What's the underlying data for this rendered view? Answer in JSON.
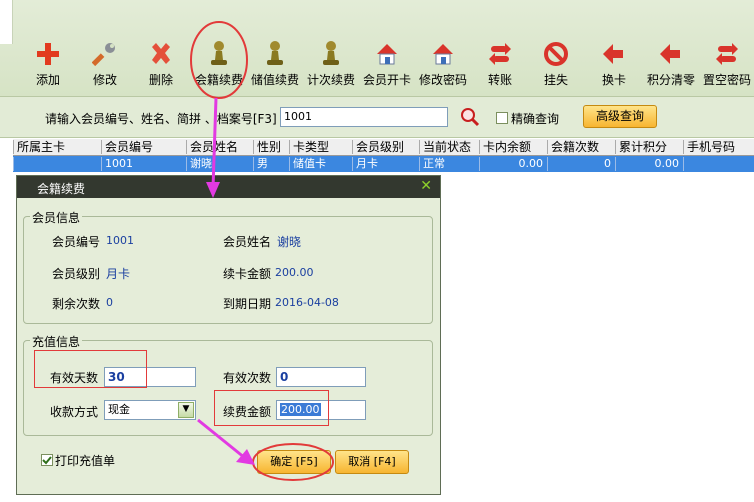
{
  "toolbar": {
    "items": [
      {
        "label": "添加",
        "icon": "plus-icon"
      },
      {
        "label": "修改",
        "icon": "wrench-icon"
      },
      {
        "label": "删除",
        "icon": "delete-x-icon"
      },
      {
        "label": "会籍续费",
        "icon": "pawn-icon"
      },
      {
        "label": "储值续费",
        "icon": "pawn-icon"
      },
      {
        "label": "计次续费",
        "icon": "pawn-icon"
      },
      {
        "label": "会员开卡",
        "icon": "house-icon"
      },
      {
        "label": "修改密码",
        "icon": "house-icon"
      },
      {
        "label": "转账",
        "icon": "transfer-icon"
      },
      {
        "label": "挂失",
        "icon": "prohibit-icon"
      },
      {
        "label": "换卡",
        "icon": "back-arrow-icon"
      },
      {
        "label": "积分清零",
        "icon": "back-arrow-icon"
      },
      {
        "label": "置空密码",
        "icon": "transfer-icon"
      }
    ]
  },
  "search": {
    "label": "请输入会员编号、姓名、简拼 、档案号[F3]",
    "value": "1001",
    "exact_label": "精确查询",
    "advanced_label": "高级查询"
  },
  "grid": {
    "columns": [
      "所属主卡",
      "会员编号",
      "会员姓名",
      "性别",
      "卡类型",
      "会员级别",
      "当前状态",
      "卡内余额",
      "会籍次数",
      "累计积分",
      "手机号码"
    ],
    "rows": [
      [
        "",
        "1001",
        "谢晓",
        "男",
        "储值卡",
        "月卡",
        "正常",
        "0.00",
        "0",
        "0.00",
        ""
      ]
    ]
  },
  "dialog": {
    "title": "会籍续费",
    "member_info": {
      "legend": "会员信息",
      "member_no_label": "会员编号",
      "member_no": "1001",
      "member_name_label": "会员姓名",
      "member_name": "谢晓",
      "level_label": "会员级别",
      "level": "月卡",
      "renew_amount_label": "续卡金额",
      "renew_amount": "200.00",
      "remaining_label": "剩余次数",
      "remaining": "0",
      "expiry_label": "到期日期",
      "expiry": "2016-04-08"
    },
    "recharge": {
      "legend": "充值信息",
      "days_label": "有效天数",
      "days": "30",
      "times_label": "有效次数",
      "times": "0",
      "payment_label": "收款方式",
      "payment": "现金",
      "fee_label": "续费金额",
      "fee": "200.00"
    },
    "print_label": "打印充值单",
    "ok_label": "确定 [F5]",
    "cancel_label": "取消 [F4]"
  },
  "colors": {
    "toolbar_bg": "#d6e3c5",
    "selected_row": "#3b87e0",
    "dialog_title": "#33382f",
    "annotation": "#e23a3a",
    "arrow": "#e23ae2"
  }
}
